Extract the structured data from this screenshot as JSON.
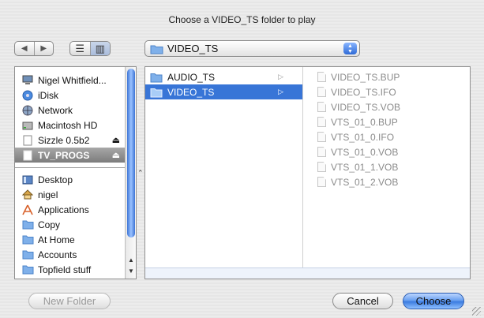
{
  "dialog": {
    "title": "Choose a VIDEO_TS folder to play"
  },
  "toolbar": {
    "back_glyph": "◀",
    "forward_glyph": "▶",
    "list_view_glyph": "☰",
    "column_view_glyph": "▥",
    "path": "VIDEO_TS",
    "popup_arrows": "▲▼"
  },
  "sidebar": {
    "devices": [
      {
        "label": "Nigel Whitfield...",
        "icon": "computer-icon"
      },
      {
        "label": "iDisk",
        "icon": "idisk-icon"
      },
      {
        "label": "Network",
        "icon": "network-icon"
      },
      {
        "label": "Macintosh HD",
        "icon": "hard-drive-icon"
      },
      {
        "label": "Sizzle 0.5b2",
        "icon": "disk-image-icon",
        "eject": "⏏"
      },
      {
        "label": "TV_PROGS",
        "icon": "volume-icon",
        "eject": "⏏",
        "selected": true
      }
    ],
    "places": [
      {
        "label": "Desktop",
        "icon": "desktop-icon"
      },
      {
        "label": "nigel",
        "icon": "home-icon"
      },
      {
        "label": "Applications",
        "icon": "applications-icon"
      },
      {
        "label": "Copy",
        "icon": "folder-icon"
      },
      {
        "label": "At Home",
        "icon": "folder-icon"
      },
      {
        "label": "Accounts",
        "icon": "folder-icon"
      },
      {
        "label": "Topfield stuff",
        "icon": "folder-icon"
      }
    ],
    "scroll_up": "▲",
    "scroll_down": "▼"
  },
  "browser": {
    "column1": [
      {
        "label": "AUDIO_TS",
        "selected": false
      },
      {
        "label": "VIDEO_TS",
        "selected": true
      }
    ],
    "disclosure": "▷",
    "column2": [
      "VIDEO_TS.BUP",
      "VIDEO_TS.IFO",
      "VIDEO_TS.VOB",
      "VTS_01_0.BUP",
      "VTS_01_0.IFO",
      "VTS_01_0.VOB",
      "VTS_01_1.VOB",
      "VTS_01_2.VOB"
    ]
  },
  "buttons": {
    "new_folder": "New Folder",
    "cancel": "Cancel",
    "choose": "Choose"
  },
  "colors": {
    "selection": "#3875d7",
    "folder": "#7fb0ea",
    "default_button": "#3b7be0"
  }
}
